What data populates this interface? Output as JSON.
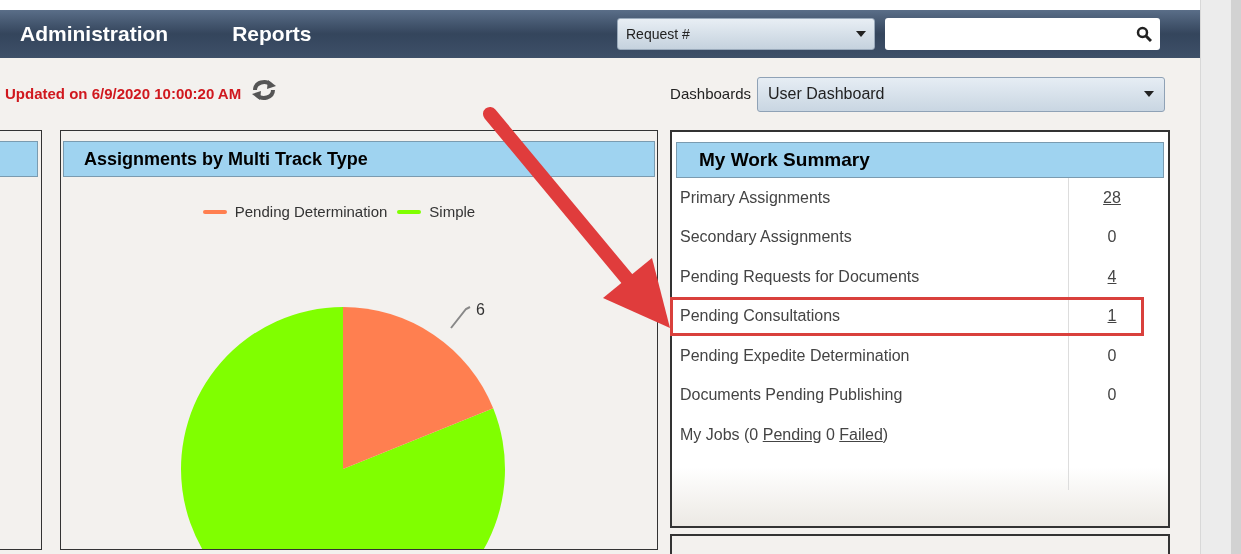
{
  "nav": {
    "items": [
      {
        "label": "Administration"
      },
      {
        "label": "Reports"
      }
    ],
    "search_type": {
      "value": "Request #"
    }
  },
  "updated": {
    "text": "Updated on 6/9/2020 10:00:20 AM"
  },
  "dashboards": {
    "label": "Dashboards",
    "value": "User Dashboard"
  },
  "chart_panel": {
    "title": "Assignments by Multi Track Type",
    "legend": [
      {
        "label": "Pending Determination",
        "color": "#ff7f50"
      },
      {
        "label": "Simple",
        "color": "#80ff00"
      }
    ],
    "slice_label": "6"
  },
  "summary": {
    "title": "My Work Summary",
    "rows": [
      {
        "label": "Primary Assignments",
        "value": "28",
        "linked": true,
        "highlighted": false
      },
      {
        "label": "Secondary Assignments",
        "value": "0",
        "linked": false,
        "highlighted": false
      },
      {
        "label": "Pending Requests for Documents",
        "value": "4",
        "linked": true,
        "highlighted": false
      },
      {
        "label": "Pending Consultations",
        "value": "1",
        "linked": true,
        "highlighted": true
      },
      {
        "label": "Pending Expedite Determination",
        "value": "0",
        "linked": false,
        "highlighted": false
      },
      {
        "label": "Documents Pending Publishing",
        "value": "0",
        "linked": false,
        "highlighted": false
      }
    ],
    "jobs": [
      {
        "kind": "text",
        "text": "My Jobs (0"
      },
      {
        "kind": "link",
        "text": "Pending"
      },
      {
        "kind": "text",
        "text": "0"
      },
      {
        "kind": "link",
        "text": "Failed"
      },
      {
        "kind": "text",
        "text": ")"
      }
    ]
  }
}
